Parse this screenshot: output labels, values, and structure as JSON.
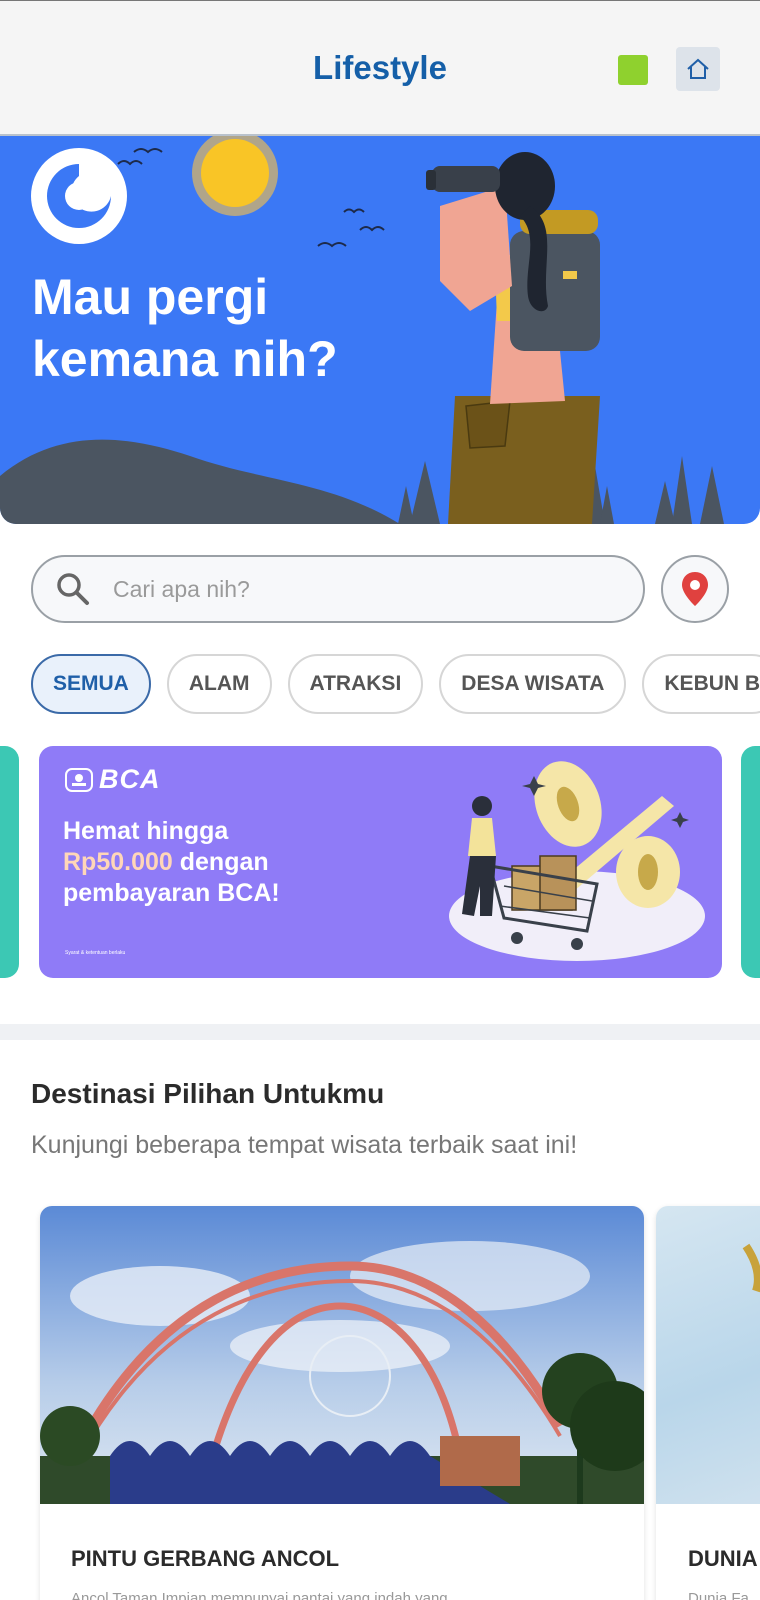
{
  "header": {
    "title": "Lifestyle"
  },
  "hero": {
    "title": "Mau pergi kemana nih?"
  },
  "search": {
    "placeholder": "Cari apa nih?"
  },
  "categories": [
    "SEMUA",
    "ALAM",
    "ATRAKSI",
    "DESA WISATA",
    "KEBUN B"
  ],
  "promo": {
    "brand": "BCA",
    "line1": "Hemat hingga",
    "highlight": "Rp50.000",
    "line2_rest": " dengan",
    "line3": "pembayaran BCA!",
    "fineprint": "Syarat & ketentuan berlaku"
  },
  "section": {
    "title": "Destinasi Pilihan Untukmu",
    "subtitle": "Kunjungi beberapa tempat wisata terbaik saat ini!"
  },
  "destinations": [
    {
      "title": "PINTU GERBANG ANCOL",
      "description": "Ancol Taman Impian mempunyai pantai yang indah yang"
    },
    {
      "title": "DUNIA F",
      "description": "Dunia Fa"
    }
  ],
  "colors": {
    "header_title": "#155fa8",
    "hero_bg": "#3b78f5",
    "promo_bg": "#8f7bf7",
    "chip_active": "#1f5fa8",
    "location_pin": "#e0413f"
  }
}
